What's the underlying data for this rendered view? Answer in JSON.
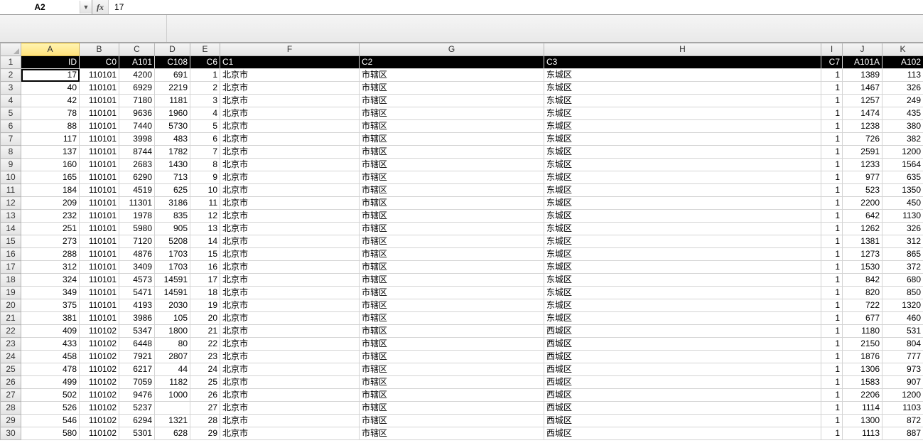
{
  "nameBox": "A2",
  "formula": "17",
  "columns": [
    "A",
    "B",
    "C",
    "D",
    "E",
    "F",
    "G",
    "H",
    "I",
    "J",
    "K"
  ],
  "headerRow": {
    "A": "ID",
    "B": "C0",
    "C": "A101",
    "D": "C108",
    "E": "C6",
    "F": "C1",
    "G": "C2",
    "H": "C3",
    "I": "C7",
    "J": "A101A",
    "K": "A102"
  },
  "alignRight": {
    "A": true,
    "B": true,
    "C": true,
    "D": true,
    "E": true,
    "I": true,
    "J": true,
    "K": true
  },
  "rows": [
    {
      "n": 2,
      "A": "17",
      "B": "110101",
      "C": "4200",
      "D": "691",
      "E": "1",
      "F": "北京市",
      "G": "市辖区",
      "H": "东城区",
      "I": "1",
      "J": "1389",
      "K": "113"
    },
    {
      "n": 3,
      "A": "40",
      "B": "110101",
      "C": "6929",
      "D": "2219",
      "E": "2",
      "F": "北京市",
      "G": "市辖区",
      "H": "东城区",
      "I": "1",
      "J": "1467",
      "K": "326"
    },
    {
      "n": 4,
      "A": "42",
      "B": "110101",
      "C": "7180",
      "D": "1181",
      "E": "3",
      "F": "北京市",
      "G": "市辖区",
      "H": "东城区",
      "I": "1",
      "J": "1257",
      "K": "249"
    },
    {
      "n": 5,
      "A": "78",
      "B": "110101",
      "C": "9636",
      "D": "1960",
      "E": "4",
      "F": "北京市",
      "G": "市辖区",
      "H": "东城区",
      "I": "1",
      "J": "1474",
      "K": "435"
    },
    {
      "n": 6,
      "A": "88",
      "B": "110101",
      "C": "7440",
      "D": "5730",
      "E": "5",
      "F": "北京市",
      "G": "市辖区",
      "H": "东城区",
      "I": "1",
      "J": "1238",
      "K": "380"
    },
    {
      "n": 7,
      "A": "117",
      "B": "110101",
      "C": "3998",
      "D": "483",
      "E": "6",
      "F": "北京市",
      "G": "市辖区",
      "H": "东城区",
      "I": "1",
      "J": "726",
      "K": "382"
    },
    {
      "n": 8,
      "A": "137",
      "B": "110101",
      "C": "8744",
      "D": "1782",
      "E": "7",
      "F": "北京市",
      "G": "市辖区",
      "H": "东城区",
      "I": "1",
      "J": "2591",
      "K": "1200"
    },
    {
      "n": 9,
      "A": "160",
      "B": "110101",
      "C": "2683",
      "D": "1430",
      "E": "8",
      "F": "北京市",
      "G": "市辖区",
      "H": "东城区",
      "I": "1",
      "J": "1233",
      "K": "1564"
    },
    {
      "n": 10,
      "A": "165",
      "B": "110101",
      "C": "6290",
      "D": "713",
      "E": "9",
      "F": "北京市",
      "G": "市辖区",
      "H": "东城区",
      "I": "1",
      "J": "977",
      "K": "635"
    },
    {
      "n": 11,
      "A": "184",
      "B": "110101",
      "C": "4519",
      "D": "625",
      "E": "10",
      "F": "北京市",
      "G": "市辖区",
      "H": "东城区",
      "I": "1",
      "J": "523",
      "K": "1350"
    },
    {
      "n": 12,
      "A": "209",
      "B": "110101",
      "C": "11301",
      "D": "3186",
      "E": "11",
      "F": "北京市",
      "G": "市辖区",
      "H": "东城区",
      "I": "1",
      "J": "2200",
      "K": "450"
    },
    {
      "n": 13,
      "A": "232",
      "B": "110101",
      "C": "1978",
      "D": "835",
      "E": "12",
      "F": "北京市",
      "G": "市辖区",
      "H": "东城区",
      "I": "1",
      "J": "642",
      "K": "1130"
    },
    {
      "n": 14,
      "A": "251",
      "B": "110101",
      "C": "5980",
      "D": "905",
      "E": "13",
      "F": "北京市",
      "G": "市辖区",
      "H": "东城区",
      "I": "1",
      "J": "1262",
      "K": "326"
    },
    {
      "n": 15,
      "A": "273",
      "B": "110101",
      "C": "7120",
      "D": "5208",
      "E": "14",
      "F": "北京市",
      "G": "市辖区",
      "H": "东城区",
      "I": "1",
      "J": "1381",
      "K": "312"
    },
    {
      "n": 16,
      "A": "288",
      "B": "110101",
      "C": "4876",
      "D": "1703",
      "E": "15",
      "F": "北京市",
      "G": "市辖区",
      "H": "东城区",
      "I": "1",
      "J": "1273",
      "K": "865"
    },
    {
      "n": 17,
      "A": "312",
      "B": "110101",
      "C": "3409",
      "D": "1703",
      "E": "16",
      "F": "北京市",
      "G": "市辖区",
      "H": "东城区",
      "I": "1",
      "J": "1530",
      "K": "372"
    },
    {
      "n": 18,
      "A": "324",
      "B": "110101",
      "C": "4573",
      "D": "14591",
      "E": "17",
      "F": "北京市",
      "G": "市辖区",
      "H": "东城区",
      "I": "1",
      "J": "842",
      "K": "680"
    },
    {
      "n": 19,
      "A": "349",
      "B": "110101",
      "C": "5471",
      "D": "14591",
      "E": "18",
      "F": "北京市",
      "G": "市辖区",
      "H": "东城区",
      "I": "1",
      "J": "820",
      "K": "850"
    },
    {
      "n": 20,
      "A": "375",
      "B": "110101",
      "C": "4193",
      "D": "2030",
      "E": "19",
      "F": "北京市",
      "G": "市辖区",
      "H": "东城区",
      "I": "1",
      "J": "722",
      "K": "1320"
    },
    {
      "n": 21,
      "A": "381",
      "B": "110101",
      "C": "3986",
      "D": "105",
      "E": "20",
      "F": "北京市",
      "G": "市辖区",
      "H": "东城区",
      "I": "1",
      "J": "677",
      "K": "460"
    },
    {
      "n": 22,
      "A": "409",
      "B": "110102",
      "C": "5347",
      "D": "1800",
      "E": "21",
      "F": "北京市",
      "G": "市辖区",
      "H": "西城区",
      "I": "1",
      "J": "1180",
      "K": "531"
    },
    {
      "n": 23,
      "A": "433",
      "B": "110102",
      "C": "6448",
      "D": "80",
      "E": "22",
      "F": "北京市",
      "G": "市辖区",
      "H": "西城区",
      "I": "1",
      "J": "2150",
      "K": "804"
    },
    {
      "n": 24,
      "A": "458",
      "B": "110102",
      "C": "7921",
      "D": "2807",
      "E": "23",
      "F": "北京市",
      "G": "市辖区",
      "H": "西城区",
      "I": "1",
      "J": "1876",
      "K": "777"
    },
    {
      "n": 25,
      "A": "478",
      "B": "110102",
      "C": "6217",
      "D": "44",
      "E": "24",
      "F": "北京市",
      "G": "市辖区",
      "H": "西城区",
      "I": "1",
      "J": "1306",
      "K": "973"
    },
    {
      "n": 26,
      "A": "499",
      "B": "110102",
      "C": "7059",
      "D": "1182",
      "E": "25",
      "F": "北京市",
      "G": "市辖区",
      "H": "西城区",
      "I": "1",
      "J": "1583",
      "K": "907"
    },
    {
      "n": 27,
      "A": "502",
      "B": "110102",
      "C": "9476",
      "D": "1000",
      "E": "26",
      "F": "北京市",
      "G": "市辖区",
      "H": "西城区",
      "I": "1",
      "J": "2206",
      "K": "1200"
    },
    {
      "n": 28,
      "A": "526",
      "B": "110102",
      "C": "5237",
      "D": "",
      "E": "27",
      "F": "北京市",
      "G": "市辖区",
      "H": "西城区",
      "I": "1",
      "J": "1114",
      "K": "1103"
    },
    {
      "n": 29,
      "A": "546",
      "B": "110102",
      "C": "6294",
      "D": "1321",
      "E": "28",
      "F": "北京市",
      "G": "市辖区",
      "H": "西城区",
      "I": "1",
      "J": "1300",
      "K": "872"
    },
    {
      "n": 30,
      "A": "580",
      "B": "110102",
      "C": "5301",
      "D": "628",
      "E": "29",
      "F": "北京市",
      "G": "市辖区",
      "H": "西城区",
      "I": "1",
      "J": "1113",
      "K": "887"
    }
  ],
  "activeCell": {
    "row": 2,
    "col": "A"
  }
}
